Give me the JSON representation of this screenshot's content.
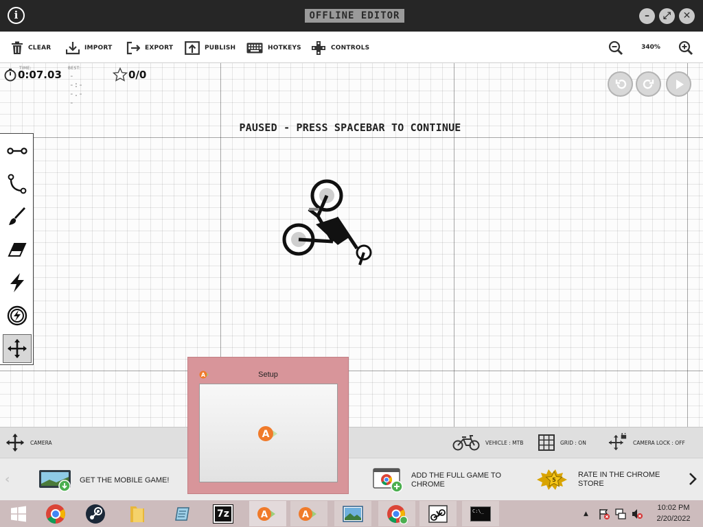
{
  "window": {
    "title": "OFFLINE EDITOR",
    "info_icon": "i",
    "minimize_glyph": "–",
    "maximize_glyph": "⤢",
    "close_glyph": "✕"
  },
  "toolbar": {
    "clear": "CLEAR",
    "import": "IMPORT",
    "export": "EXPORT",
    "publish": "PUBLISH",
    "hotkeys": "HOTKEYS",
    "controls": "CONTROLS",
    "zoom": "340%"
  },
  "hud": {
    "time_label": "TIME:",
    "time_value": "0:07.03",
    "best_label": "BEST:",
    "best_value": "--:--.--",
    "stars": "0/0"
  },
  "status": {
    "paused_message": "PAUSED - PRESS SPACEBAR TO CONTINUE"
  },
  "tools": [
    {
      "name": "straight-line-tool",
      "icon": "line-icon",
      "active": false
    },
    {
      "name": "curve-tool",
      "icon": "curve-icon",
      "active": false
    },
    {
      "name": "brush-tool",
      "icon": "brush-icon",
      "active": false
    },
    {
      "name": "eraser-tool",
      "icon": "eraser-icon",
      "active": false
    },
    {
      "name": "powerup-tool",
      "icon": "lightning-icon",
      "active": false
    },
    {
      "name": "boost-tool",
      "icon": "boost-circle-icon",
      "active": false
    },
    {
      "name": "camera-tool",
      "icon": "move-arrows-icon",
      "active": true
    }
  ],
  "statusbar": {
    "camera": "CAMERA",
    "vehicle": "VEHICLE : MTB",
    "grid": "GRID : ON",
    "camera_lock": "CAMERA LOCK : OFF"
  },
  "promos": {
    "mobile": "GET THE MOBILE GAME!",
    "chrome_line1": "ADD THE FULL GAME TO",
    "chrome_line2": "CHROME",
    "rate_line1": "RATE IN THE CHROME",
    "rate_line2": "STORE",
    "rate_star_number": "5"
  },
  "setup_dialog": {
    "title": "Setup"
  },
  "taskbar": {
    "time": "10:02 PM",
    "date": "2/20/2022",
    "seven_zip_label": "7z",
    "console_label": "C:\\_"
  },
  "colors": {
    "titlebar": "#262626",
    "setup_dialog": "#d8959a",
    "taskbar": "#cdbcbd",
    "accent_orange": "#f07a2a",
    "accent_green": "#4caf50"
  }
}
